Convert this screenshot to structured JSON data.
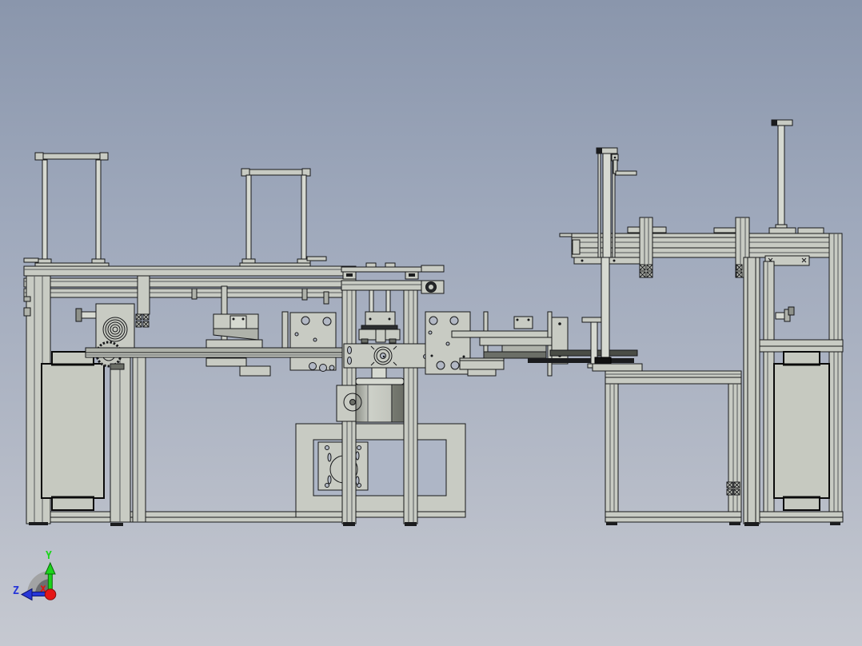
{
  "scene": {
    "type": "CAD assembly side view viewport",
    "background_top_color": "#8a96ac",
    "background_bottom_color": "#c6c9d1",
    "machine_body_color": "#c8cbc3",
    "machine_outline_color": "#17181a"
  },
  "triad": {
    "y_label": "Y",
    "z_label": "Z",
    "x_label": "x",
    "y_color": "#1cd41c",
    "z_color": "#2736d8",
    "x_color": "#e11212"
  }
}
